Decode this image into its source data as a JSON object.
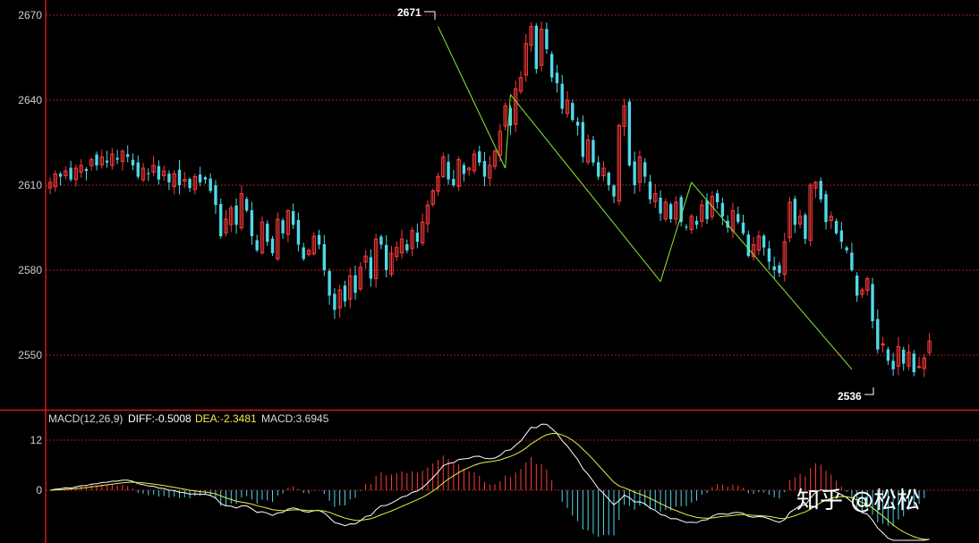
{
  "chart_data": [
    {
      "type": "candlestick",
      "y_ticks": [
        2670,
        2640,
        2610,
        2580,
        2550
      ],
      "ylim": [
        2535,
        2674
      ],
      "grid": true,
      "colors": {
        "up": "#ff3b3b",
        "down": "#4fd8e8",
        "trend": "#88ee33",
        "grid": "#b01a1a",
        "axis": "#d01a1a"
      },
      "annotations": {
        "high_label": "2671",
        "low_label": "2536"
      },
      "x_note": "bars indexed 0..170, no date labels shown",
      "closes": [
        2611,
        2614,
        2613,
        2615,
        2612,
        2616,
        2617,
        2615,
        2619,
        2617,
        2620,
        2618,
        2621,
        2619,
        2622,
        2620,
        2617,
        2613,
        2616,
        2614,
        2617,
        2612,
        2615,
        2611,
        2614,
        2610,
        2612,
        2609,
        2613,
        2611,
        2612,
        2608,
        2603,
        2592,
        2598,
        2602,
        2596,
        2607,
        2601,
        2592,
        2587,
        2597,
        2590,
        2586,
        2598,
        2593,
        2601,
        2596,
        2589,
        2584,
        2587,
        2592,
        2589,
        2580,
        2571,
        2566,
        2573,
        2569,
        2578,
        2572,
        2581,
        2585,
        2577,
        2591,
        2589,
        2580,
        2586,
        2588,
        2591,
        2587,
        2594,
        2590,
        2597,
        2603,
        2608,
        2613,
        2620,
        2612,
        2610,
        2619,
        2614,
        2616,
        2621,
        2618,
        2613,
        2617,
        2622,
        2629,
        2638,
        2631,
        2644,
        2648,
        2660,
        2666,
        2651,
        2665,
        2658,
        2648,
        2646,
        2637,
        2640,
        2633,
        2631,
        2620,
        2626,
        2618,
        2613,
        2616,
        2610,
        2606,
        2631,
        2638,
        2617,
        2610,
        2620,
        2613,
        2605,
        2607,
        2600,
        2604,
        2598,
        2604,
        2597,
        2595,
        2599,
        2596,
        2603,
        2598,
        2606,
        2604,
        2599,
        2595,
        2601,
        2597,
        2593,
        2585,
        2589,
        2592,
        2588,
        2583,
        2580,
        2579,
        2590,
        2604,
        2596,
        2599,
        2591,
        2610,
        2611,
        2605,
        2597,
        2599,
        2593,
        2590,
        2587,
        2580,
        2571,
        2573,
        2577,
        2562,
        2552,
        2554,
        2548,
        2545,
        2553,
        2547,
        2551,
        2544,
        2546,
        2549,
        2555
      ],
      "series": [
        {
          "name": "DIFF",
          "color": "#ffffff"
        },
        {
          "name": "DEA",
          "color": "#eeee44"
        }
      ]
    },
    {
      "type": "macd",
      "indicator_label": "MACD(12,26,9)",
      "diff_label": "DIFF:-0.5008",
      "dea_label": "DEA:-2.3481",
      "macd_label": "MACD:3.6945",
      "y_ticks": [
        12,
        0
      ],
      "colors": {
        "label": "#d8d8d8",
        "diff": "#ffffff",
        "dea": "#eeee44",
        "macd": "#d8d8d8",
        "pos": "#ff3b3b",
        "neg": "#4fd8e8"
      }
    }
  ],
  "watermark": "知乎 @松松"
}
